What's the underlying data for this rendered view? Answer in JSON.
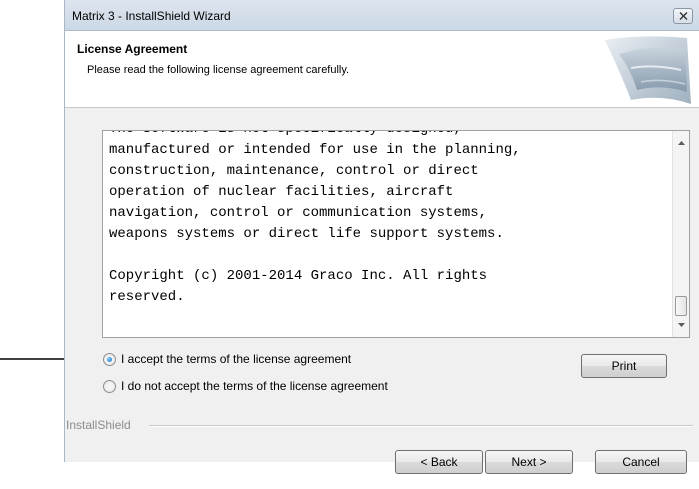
{
  "window": {
    "title": "Matrix 3 - InstallShield Wizard"
  },
  "header": {
    "title": "License Agreement",
    "subtitle": "Please read the following license agreement carefully."
  },
  "license": {
    "text": "The Software is not specifically designed,\nmanufactured or intended for use in the planning,\nconstruction, maintenance, control or direct\noperation of nuclear facilities, aircraft\nnavigation, control or communication systems,\nweapons systems or direct life support systems.\n\nCopyright (c) 2001-2014 Graco Inc. All rights\nreserved."
  },
  "options": {
    "accept_label": "I accept the terms of the license agreement",
    "decline_label": "I do not accept the terms of the license agreement",
    "selected": "accept"
  },
  "buttons": {
    "print": "Print",
    "back": "< Back",
    "next": "Next >",
    "cancel": "Cancel"
  },
  "footer": {
    "brand": "InstallShield"
  },
  "icons": [
    "close-icon",
    "scroll-up-arrow-icon",
    "scroll-down-arrow-icon",
    "installshield-banner-logo-icon",
    "pointer-arrow-icon"
  ]
}
